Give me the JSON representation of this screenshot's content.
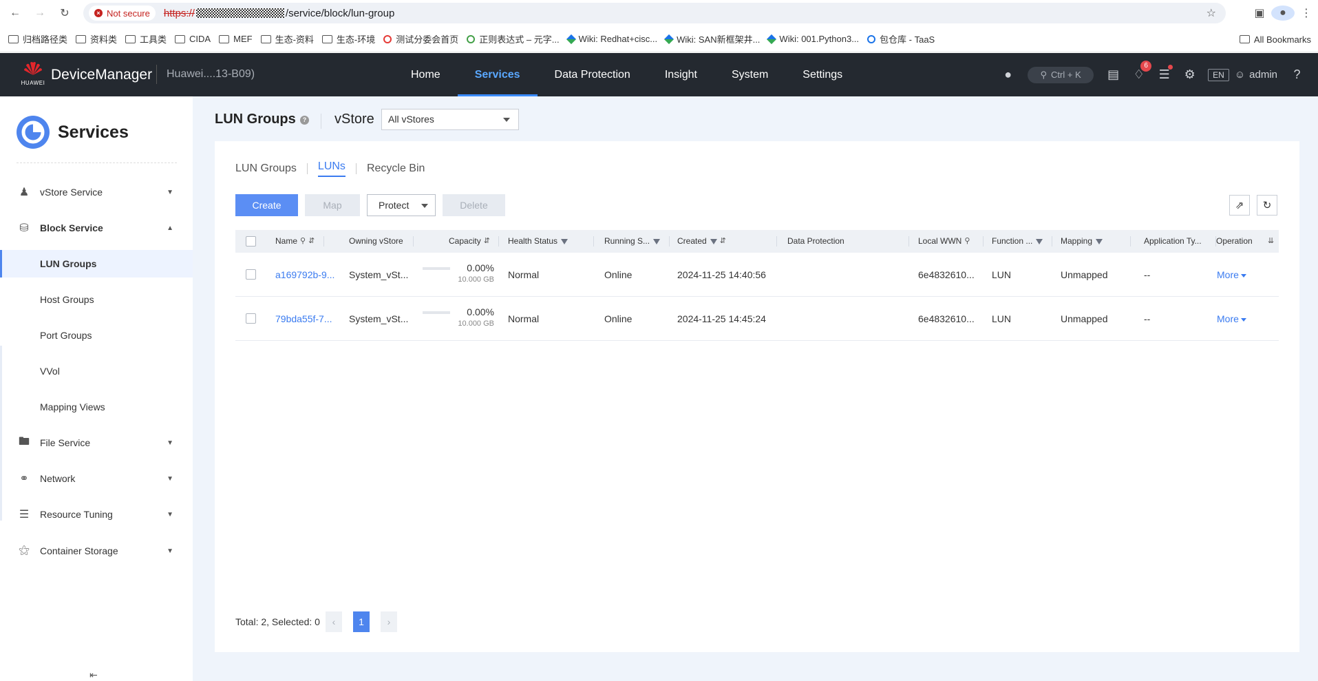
{
  "browser": {
    "security_label": "Not secure",
    "url_scheme": "https://",
    "url_path": "/service/block/lun-group",
    "bookmarks": [
      {
        "label": "归档路径类",
        "icon": "folder-icon"
      },
      {
        "label": "资料类",
        "icon": "folder-icon"
      },
      {
        "label": "工具类",
        "icon": "folder-icon"
      },
      {
        "label": "CIDA",
        "icon": "folder-icon"
      },
      {
        "label": "MEF",
        "icon": "folder-icon"
      },
      {
        "label": "生态-资料",
        "icon": "folder-icon"
      },
      {
        "label": "生态-环境",
        "icon": "folder-icon"
      },
      {
        "label": "测试分委会首页",
        "icon": "site-icon"
      },
      {
        "label": "正则表达式 – 元字...",
        "icon": "site-icon"
      },
      {
        "label": "Wiki: Redhat+cisc...",
        "icon": "wiki-icon"
      },
      {
        "label": "Wiki: SAN新框架井...",
        "icon": "wiki-icon"
      },
      {
        "label": "Wiki: 001.Python3...",
        "icon": "wiki-icon"
      },
      {
        "label": "包仓库 - TaaS",
        "icon": "site-icon"
      }
    ],
    "all_bookmarks": "All Bookmarks"
  },
  "header": {
    "brand_text": "HUAWEI",
    "app_name": "DeviceManager",
    "device_name": "Huawei....13-B09)",
    "nav": [
      "Home",
      "Services",
      "Data Protection",
      "Insight",
      "System",
      "Settings"
    ],
    "active_nav": "Services",
    "search_hint": "Ctrl + K",
    "alarm_count": "6",
    "language": "EN",
    "user": "admin"
  },
  "sidebar": {
    "title": "Services",
    "vstore_service": "vStore Service",
    "block_service": "Block Service",
    "sub_items": [
      "LUN Groups",
      "Host Groups",
      "Port Groups",
      "VVol",
      "Mapping Views"
    ],
    "active_sub": "LUN Groups",
    "file_service": "File Service",
    "network": "Network",
    "resource_tuning": "Resource Tuning",
    "container_storage": "Container Storage"
  },
  "page": {
    "title": "LUN Groups",
    "vstore_label": "vStore",
    "vstore_value": "All vStores",
    "tabs": [
      "LUN Groups",
      "LUNs",
      "Recycle Bin"
    ],
    "active_tab": "LUNs"
  },
  "toolbar": {
    "create": "Create",
    "map": "Map",
    "protect": "Protect",
    "delete": "Delete"
  },
  "table": {
    "columns": {
      "name": "Name",
      "owning_vstore": "Owning vStore",
      "capacity": "Capacity",
      "health_status": "Health Status",
      "running_status": "Running S...",
      "created": "Created",
      "data_protection": "Data Protection",
      "local_wwn": "Local WWN",
      "function": "Function ...",
      "mapping": "Mapping",
      "application_type": "Application Ty...",
      "operation": "Operation"
    },
    "rows": [
      {
        "name": "a169792b-9...",
        "owning_vstore": "System_vSt...",
        "capacity_used_pct": "0.00%",
        "capacity_total": "10.000 GB",
        "health_status": "Normal",
        "running_status": "Online",
        "created": "2024-11-25 14:40:56",
        "data_protection": "",
        "local_wwn": "6e4832610...",
        "function": "LUN",
        "mapping": "Unmapped",
        "application_type": "--",
        "operation": "More"
      },
      {
        "name": "79bda55f-7...",
        "owning_vstore": "System_vSt...",
        "capacity_used_pct": "0.00%",
        "capacity_total": "10.000 GB",
        "health_status": "Normal",
        "running_status": "Online",
        "created": "2024-11-25 14:45:24",
        "data_protection": "",
        "local_wwn": "6e4832610...",
        "function": "LUN",
        "mapping": "Unmapped",
        "application_type": "--",
        "operation": "More"
      }
    ]
  },
  "pagination": {
    "summary": "Total: 2, Selected: 0",
    "current_page": "1"
  },
  "colors": {
    "header_bg": "#242930",
    "accent": "#3a7bf0",
    "primary_button": "#5b8ef4",
    "main_bg": "#eff4fb"
  }
}
